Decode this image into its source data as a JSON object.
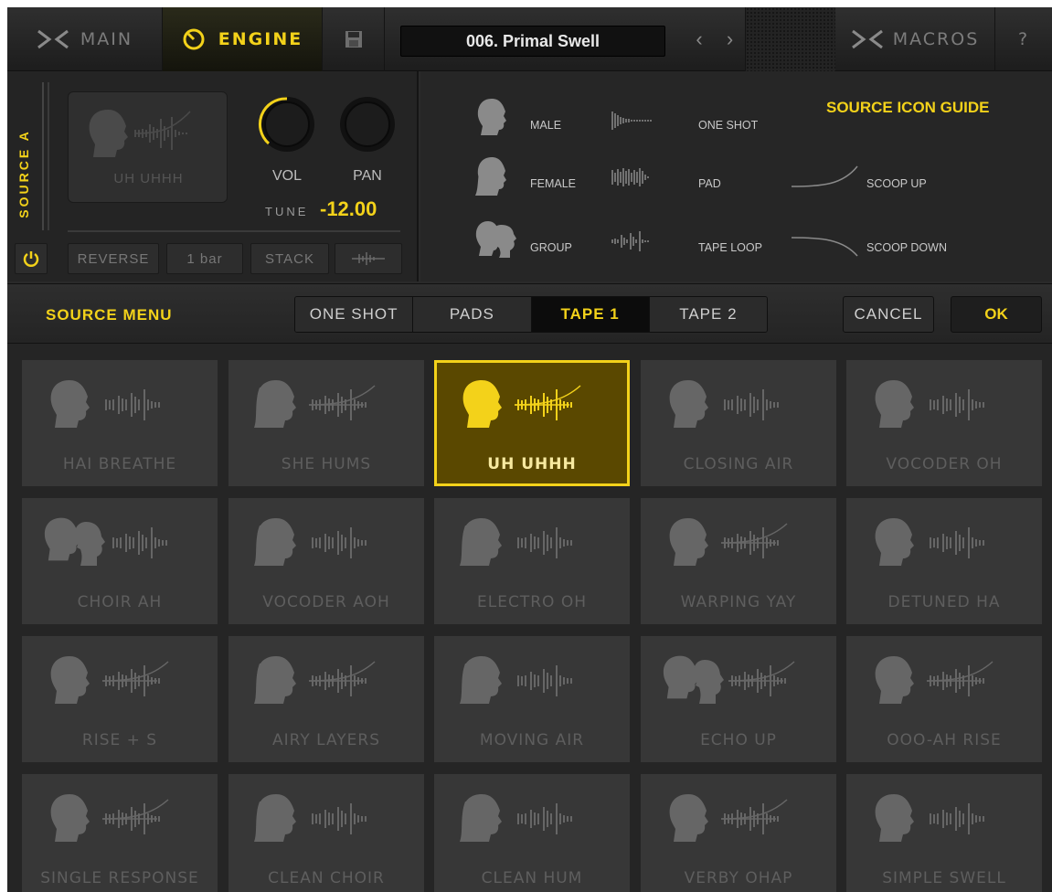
{
  "topbar": {
    "main_label": "MAIN",
    "engine_label": "ENGINE",
    "preset_name": "006. Primal Swell",
    "prev_label": "‹",
    "next_label": "›",
    "macros_label": "MACROS",
    "help_label": "?"
  },
  "source": {
    "label": "SOURCE A",
    "sample_name": "UH UHHH",
    "vol_label": "VOL",
    "pan_label": "PAN",
    "tune_label": "TUNE",
    "tune_value": "-12.00",
    "reverse_label": "REVERSE",
    "length_label": "1 bar",
    "stack_label": "STACK"
  },
  "guide": {
    "title": "SOURCE ICON GUIDE",
    "voices": [
      "MALE",
      "FEMALE",
      "GROUP"
    ],
    "types": [
      "ONE SHOT",
      "PAD",
      "TAPE LOOP"
    ],
    "scoops": [
      "SCOOP UP",
      "SCOOP DOWN"
    ]
  },
  "menu": {
    "label": "SOURCE MENU",
    "tabs": [
      "ONE SHOT",
      "PADS",
      "TAPE 1",
      "TAPE 2"
    ],
    "active_tab": "TAPE 1",
    "cancel_label": "CANCEL",
    "ok_label": "OK"
  },
  "colors": {
    "accent": "#f3d21a",
    "tile": "#373737",
    "selected_tile": "#5a4800"
  },
  "tiles": [
    {
      "name": "HAI BREATHE",
      "voice": "male",
      "wave": "tape",
      "scoop": false
    },
    {
      "name": "SHE HUMS",
      "voice": "female",
      "wave": "tape",
      "scoop": true
    },
    {
      "name": "UH UHHH",
      "voice": "male",
      "wave": "tape",
      "scoop": true,
      "selected": true
    },
    {
      "name": "CLOSING AIR",
      "voice": "male",
      "wave": "tape",
      "scoop": false
    },
    {
      "name": "VOCODER OH",
      "voice": "male",
      "wave": "tape",
      "scoop": false
    },
    {
      "name": "CHOIR AH",
      "voice": "group",
      "wave": "tape",
      "scoop": false
    },
    {
      "name": "VOCODER AOH",
      "voice": "female",
      "wave": "tape",
      "scoop": false
    },
    {
      "name": "ELECTRO OH",
      "voice": "female",
      "wave": "tape",
      "scoop": false
    },
    {
      "name": "WARPING YAY",
      "voice": "male",
      "wave": "tape",
      "scoop": true
    },
    {
      "name": "DETUNED HA",
      "voice": "male",
      "wave": "tape",
      "scoop": false
    },
    {
      "name": "RISE + S",
      "voice": "male",
      "wave": "tape",
      "scoop": true
    },
    {
      "name": "AIRY LAYERS",
      "voice": "female",
      "wave": "tape",
      "scoop": true
    },
    {
      "name": "MOVING AIR",
      "voice": "female",
      "wave": "tape",
      "scoop": false
    },
    {
      "name": "ECHO UP",
      "voice": "group",
      "wave": "tape",
      "scoop": true
    },
    {
      "name": "OOO-AH RISE",
      "voice": "male",
      "wave": "tape",
      "scoop": true
    },
    {
      "name": "SINGLE RESPONSE",
      "voice": "male",
      "wave": "tape",
      "scoop": true
    },
    {
      "name": "CLEAN CHOIR",
      "voice": "female",
      "wave": "tape",
      "scoop": false
    },
    {
      "name": "CLEAN HUM",
      "voice": "female",
      "wave": "tape",
      "scoop": false
    },
    {
      "name": "VERBY OHAP",
      "voice": "male",
      "wave": "tape",
      "scoop": true
    },
    {
      "name": "SIMPLE SWELL",
      "voice": "male",
      "wave": "tape",
      "scoop": false
    }
  ]
}
